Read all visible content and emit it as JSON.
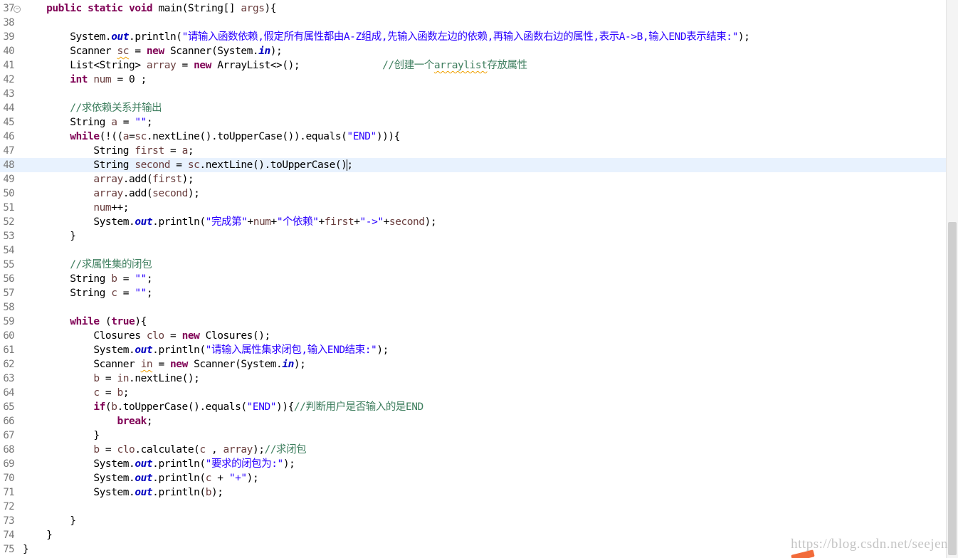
{
  "editor": {
    "current_line": "48",
    "lines": [
      {
        "n": "37",
        "fold": true,
        "segs": [
          {
            "t": "    "
          },
          {
            "t": "public",
            "c": "kw"
          },
          {
            "t": " "
          },
          {
            "t": "static",
            "c": "kw"
          },
          {
            "t": " "
          },
          {
            "t": "void",
            "c": "kw"
          },
          {
            "t": " main(String[] "
          },
          {
            "t": "args",
            "c": "var"
          },
          {
            "t": "){"
          }
        ]
      },
      {
        "n": "38",
        "segs": []
      },
      {
        "n": "39",
        "segs": [
          {
            "t": "        System."
          },
          {
            "t": "out",
            "c": "fld"
          },
          {
            "t": ".println("
          },
          {
            "t": "\"请输入函数依赖,假定所有属性都由A-Z组成,先输入函数左边的依赖,再输入函数右边的属性,表示A->B,输入END表示结束:\"",
            "c": "str"
          },
          {
            "t": ");"
          }
        ]
      },
      {
        "n": "40",
        "segs": [
          {
            "t": "        Scanner "
          },
          {
            "t": "sc",
            "c": "var wv"
          },
          {
            "t": " = "
          },
          {
            "t": "new",
            "c": "kw"
          },
          {
            "t": " Scanner(System."
          },
          {
            "t": "in",
            "c": "fld"
          },
          {
            "t": ");"
          }
        ]
      },
      {
        "n": "41",
        "segs": [
          {
            "t": "        List<String> "
          },
          {
            "t": "array",
            "c": "var"
          },
          {
            "t": " = "
          },
          {
            "t": "new",
            "c": "kw"
          },
          {
            "t": " ArrayList<>();              "
          },
          {
            "t": "//创建一个",
            "c": "cm"
          },
          {
            "t": "arraylist",
            "c": "cm wv"
          },
          {
            "t": "存放属性",
            "c": "cm"
          }
        ]
      },
      {
        "n": "42",
        "segs": [
          {
            "t": "        "
          },
          {
            "t": "int",
            "c": "kw"
          },
          {
            "t": " "
          },
          {
            "t": "num",
            "c": "var"
          },
          {
            "t": " = 0 ;"
          }
        ]
      },
      {
        "n": "43",
        "segs": []
      },
      {
        "n": "44",
        "segs": [
          {
            "t": "        "
          },
          {
            "t": "//求依赖关系并输出",
            "c": "cm"
          }
        ]
      },
      {
        "n": "45",
        "segs": [
          {
            "t": "        String "
          },
          {
            "t": "a",
            "c": "var"
          },
          {
            "t": " = "
          },
          {
            "t": "\"\"",
            "c": "str"
          },
          {
            "t": ";"
          }
        ]
      },
      {
        "n": "46",
        "segs": [
          {
            "t": "        "
          },
          {
            "t": "while",
            "c": "kw"
          },
          {
            "t": "(!(("
          },
          {
            "t": "a",
            "c": "var"
          },
          {
            "t": "="
          },
          {
            "t": "sc",
            "c": "var"
          },
          {
            "t": ".nextLine().toUpperCase()).equals("
          },
          {
            "t": "\"END\"",
            "c": "str"
          },
          {
            "t": "))){"
          }
        ]
      },
      {
        "n": "47",
        "segs": [
          {
            "t": "            String "
          },
          {
            "t": "first",
            "c": "var"
          },
          {
            "t": " = "
          },
          {
            "t": "a",
            "c": "var"
          },
          {
            "t": ";"
          }
        ]
      },
      {
        "n": "48",
        "segs": [
          {
            "t": "            String "
          },
          {
            "t": "second",
            "c": "var"
          },
          {
            "t": " = "
          },
          {
            "t": "sc",
            "c": "var"
          },
          {
            "t": ".nextLine().toUpperCase()"
          },
          {
            "caret": true
          },
          {
            "t": ";"
          }
        ]
      },
      {
        "n": "49",
        "segs": [
          {
            "t": "            "
          },
          {
            "t": "array",
            "c": "var"
          },
          {
            "t": ".add("
          },
          {
            "t": "first",
            "c": "var"
          },
          {
            "t": ");"
          }
        ]
      },
      {
        "n": "50",
        "segs": [
          {
            "t": "            "
          },
          {
            "t": "array",
            "c": "var"
          },
          {
            "t": ".add("
          },
          {
            "t": "second",
            "c": "var"
          },
          {
            "t": ");"
          }
        ]
      },
      {
        "n": "51",
        "segs": [
          {
            "t": "            "
          },
          {
            "t": "num",
            "c": "var"
          },
          {
            "t": "++;"
          }
        ]
      },
      {
        "n": "52",
        "segs": [
          {
            "t": "            System."
          },
          {
            "t": "out",
            "c": "fld"
          },
          {
            "t": ".println("
          },
          {
            "t": "\"完成第\"",
            "c": "str"
          },
          {
            "t": "+"
          },
          {
            "t": "num",
            "c": "var"
          },
          {
            "t": "+"
          },
          {
            "t": "\"个依赖\"",
            "c": "str"
          },
          {
            "t": "+"
          },
          {
            "t": "first",
            "c": "var"
          },
          {
            "t": "+"
          },
          {
            "t": "\"->\"",
            "c": "str"
          },
          {
            "t": "+"
          },
          {
            "t": "second",
            "c": "var"
          },
          {
            "t": ");"
          }
        ]
      },
      {
        "n": "53",
        "segs": [
          {
            "t": "        }"
          }
        ]
      },
      {
        "n": "54",
        "segs": []
      },
      {
        "n": "55",
        "segs": [
          {
            "t": "        "
          },
          {
            "t": "//求属性集的闭包",
            "c": "cm"
          }
        ]
      },
      {
        "n": "56",
        "segs": [
          {
            "t": "        String "
          },
          {
            "t": "b",
            "c": "var"
          },
          {
            "t": " = "
          },
          {
            "t": "\"\"",
            "c": "str"
          },
          {
            "t": ";"
          }
        ]
      },
      {
        "n": "57",
        "segs": [
          {
            "t": "        String "
          },
          {
            "t": "c",
            "c": "var"
          },
          {
            "t": " = "
          },
          {
            "t": "\"\"",
            "c": "str"
          },
          {
            "t": ";"
          }
        ]
      },
      {
        "n": "58",
        "segs": []
      },
      {
        "n": "59",
        "segs": [
          {
            "t": "        "
          },
          {
            "t": "while",
            "c": "kw"
          },
          {
            "t": " ("
          },
          {
            "t": "true",
            "c": "kw"
          },
          {
            "t": "){"
          }
        ]
      },
      {
        "n": "60",
        "segs": [
          {
            "t": "            Closures "
          },
          {
            "t": "clo",
            "c": "var"
          },
          {
            "t": " = "
          },
          {
            "t": "new",
            "c": "kw"
          },
          {
            "t": " Closures();"
          }
        ]
      },
      {
        "n": "61",
        "segs": [
          {
            "t": "            System."
          },
          {
            "t": "out",
            "c": "fld"
          },
          {
            "t": ".println("
          },
          {
            "t": "\"请输入属性集求闭包,输入END结束:\"",
            "c": "str"
          },
          {
            "t": ");"
          }
        ]
      },
      {
        "n": "62",
        "segs": [
          {
            "t": "            Scanner "
          },
          {
            "t": "in",
            "c": "var wv"
          },
          {
            "t": " = "
          },
          {
            "t": "new",
            "c": "kw"
          },
          {
            "t": " Scanner(System."
          },
          {
            "t": "in",
            "c": "fld"
          },
          {
            "t": ");"
          }
        ]
      },
      {
        "n": "63",
        "segs": [
          {
            "t": "            "
          },
          {
            "t": "b",
            "c": "var"
          },
          {
            "t": " = "
          },
          {
            "t": "in",
            "c": "var"
          },
          {
            "t": ".nextLine();"
          }
        ]
      },
      {
        "n": "64",
        "segs": [
          {
            "t": "            "
          },
          {
            "t": "c",
            "c": "var"
          },
          {
            "t": " = "
          },
          {
            "t": "b",
            "c": "var"
          },
          {
            "t": ";"
          }
        ]
      },
      {
        "n": "65",
        "segs": [
          {
            "t": "            "
          },
          {
            "t": "if",
            "c": "kw"
          },
          {
            "t": "("
          },
          {
            "t": "b",
            "c": "var"
          },
          {
            "t": ".toUpperCase().equals("
          },
          {
            "t": "\"END\"",
            "c": "str"
          },
          {
            "t": ")){"
          },
          {
            "t": "//判断用户是否输入的是END",
            "c": "cm"
          }
        ]
      },
      {
        "n": "66",
        "segs": [
          {
            "t": "                "
          },
          {
            "t": "break",
            "c": "kw"
          },
          {
            "t": ";"
          }
        ]
      },
      {
        "n": "67",
        "segs": [
          {
            "t": "            }"
          }
        ]
      },
      {
        "n": "68",
        "segs": [
          {
            "t": "            "
          },
          {
            "t": "b",
            "c": "var"
          },
          {
            "t": " = "
          },
          {
            "t": "clo",
            "c": "var"
          },
          {
            "t": ".calculate("
          },
          {
            "t": "c",
            "c": "var"
          },
          {
            "t": " , "
          },
          {
            "t": "array",
            "c": "var"
          },
          {
            "t": ");"
          },
          {
            "t": "//求闭包",
            "c": "cm"
          }
        ]
      },
      {
        "n": "69",
        "segs": [
          {
            "t": "            System."
          },
          {
            "t": "out",
            "c": "fld"
          },
          {
            "t": ".println("
          },
          {
            "t": "\"要求的闭包为:\"",
            "c": "str"
          },
          {
            "t": ");"
          }
        ]
      },
      {
        "n": "70",
        "segs": [
          {
            "t": "            System."
          },
          {
            "t": "out",
            "c": "fld"
          },
          {
            "t": ".println("
          },
          {
            "t": "c",
            "c": "var"
          },
          {
            "t": " + "
          },
          {
            "t": "\"+\"",
            "c": "str"
          },
          {
            "t": ");"
          }
        ]
      },
      {
        "n": "71",
        "segs": [
          {
            "t": "            System."
          },
          {
            "t": "out",
            "c": "fld"
          },
          {
            "t": ".println("
          },
          {
            "t": "b",
            "c": "var"
          },
          {
            "t": ");"
          }
        ]
      },
      {
        "n": "72",
        "segs": []
      },
      {
        "n": "73",
        "segs": [
          {
            "t": "        }"
          }
        ]
      },
      {
        "n": "74",
        "segs": [
          {
            "t": "    }"
          }
        ]
      },
      {
        "n": "75",
        "segs": [
          {
            "t": "}"
          }
        ]
      }
    ]
  },
  "watermark": {
    "text": "https://blog.csdn.net/seejen"
  },
  "colors": {
    "keyword": "#7f0055",
    "string": "#2a00ff",
    "comment": "#3f7f5f",
    "static_field": "#0000c0",
    "local_var": "#6a3e3e",
    "current_line_bg": "#e8f2fe"
  }
}
